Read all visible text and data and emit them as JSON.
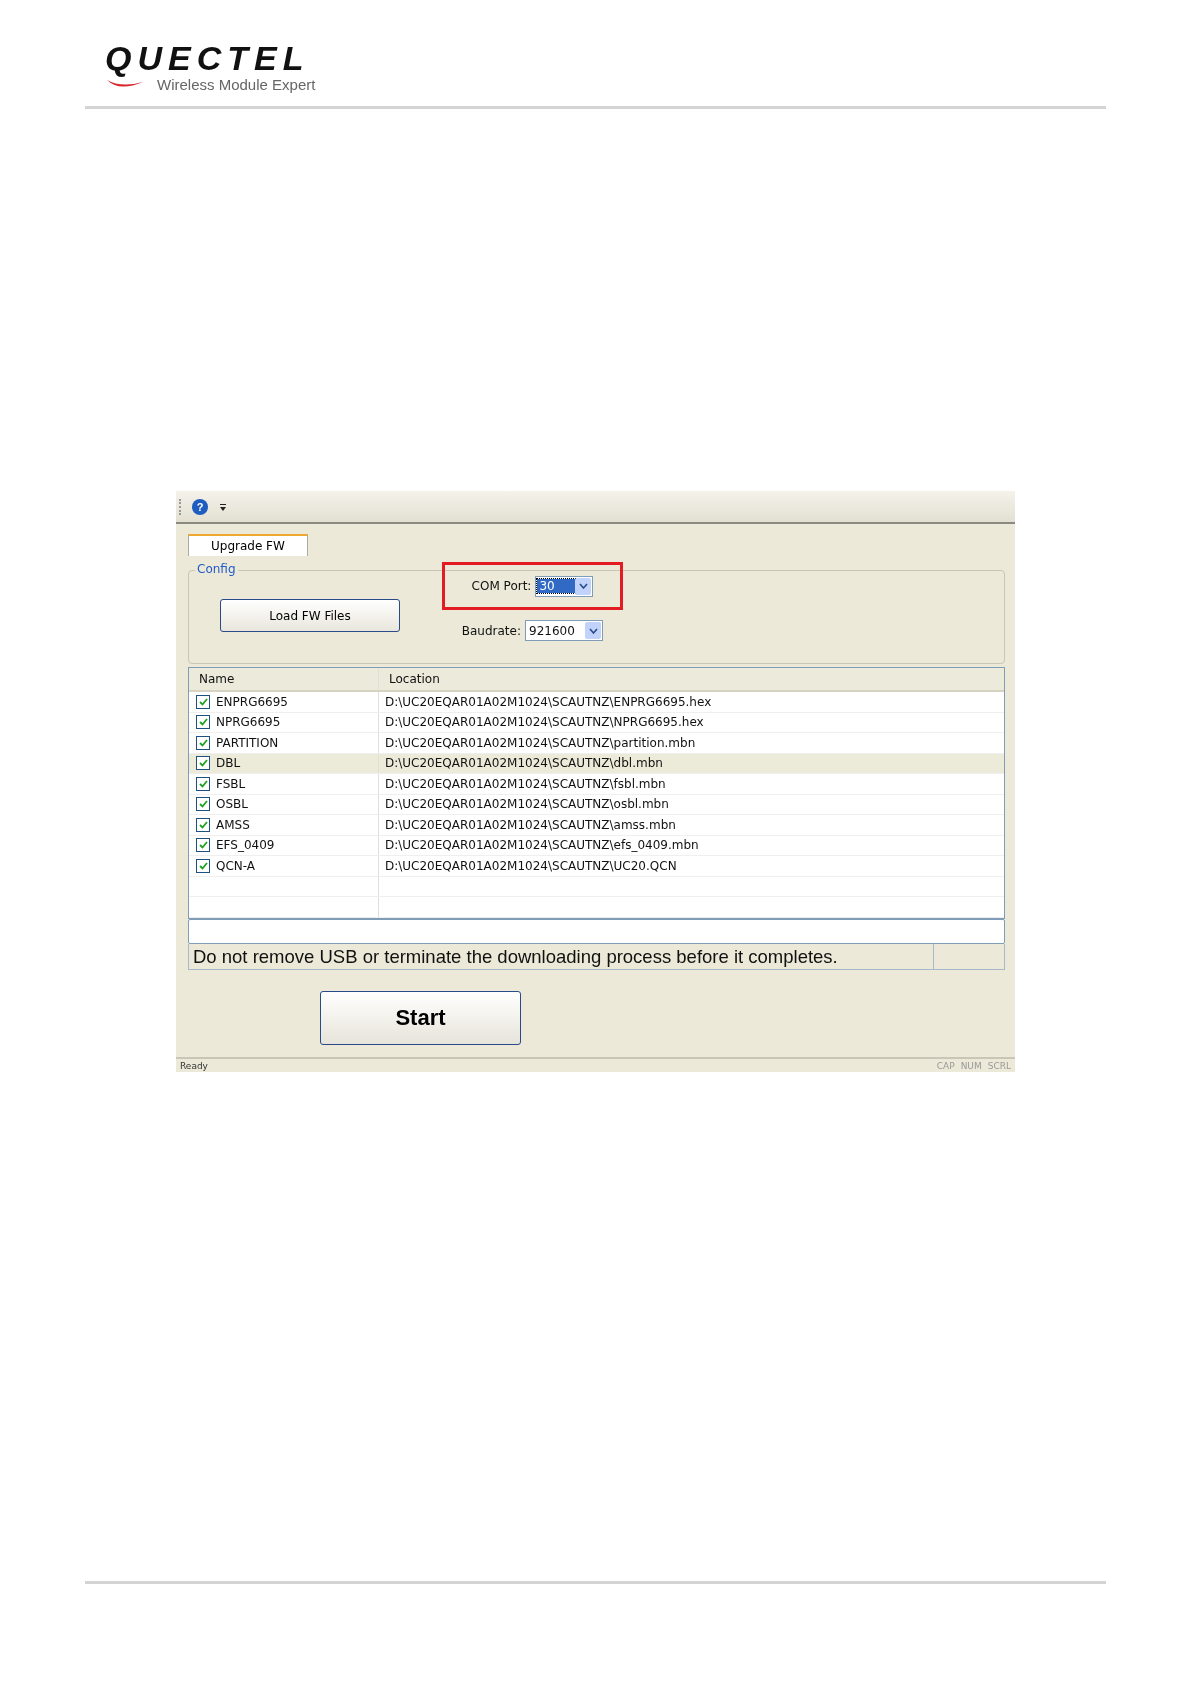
{
  "header": {
    "logo": "QUECTEL",
    "tagline": "Wireless Module Expert"
  },
  "window": {
    "toolbar": {
      "help_button": "?"
    },
    "tabs": [
      {
        "label": "Upgrade FW",
        "selected": true
      }
    ],
    "config": {
      "title": "Config",
      "load_button": "Load FW Files",
      "com_port": {
        "label": "COM Port:",
        "value": "30",
        "highlighted": true
      },
      "baudrate": {
        "label": "Baudrate:",
        "value": "921600"
      }
    },
    "table": {
      "columns": [
        "Name",
        "Location"
      ],
      "rows": [
        {
          "name": "ENPRG6695",
          "location": "D:\\UC20EQAR01A02M1024\\SCAUTNZ\\ENPRG6695.hex",
          "checked": true,
          "selected": false
        },
        {
          "name": "NPRG6695",
          "location": "D:\\UC20EQAR01A02M1024\\SCAUTNZ\\NPRG6695.hex",
          "checked": true,
          "selected": false
        },
        {
          "name": "PARTITION",
          "location": "D:\\UC20EQAR01A02M1024\\SCAUTNZ\\partition.mbn",
          "checked": true,
          "selected": false
        },
        {
          "name": "DBL",
          "location": "D:\\UC20EQAR01A02M1024\\SCAUTNZ\\dbl.mbn",
          "checked": true,
          "selected": true
        },
        {
          "name": "FSBL",
          "location": "D:\\UC20EQAR01A02M1024\\SCAUTNZ\\fsbl.mbn",
          "checked": true,
          "selected": false
        },
        {
          "name": "OSBL",
          "location": "D:\\UC20EQAR01A02M1024\\SCAUTNZ\\osbl.mbn",
          "checked": true,
          "selected": false
        },
        {
          "name": "AMSS",
          "location": "D:\\UC20EQAR01A02M1024\\SCAUTNZ\\amss.mbn",
          "checked": true,
          "selected": false
        },
        {
          "name": "EFS_0409",
          "location": "D:\\UC20EQAR01A02M1024\\SCAUTNZ\\efs_0409.mbn",
          "checked": true,
          "selected": false
        },
        {
          "name": "QCN-A",
          "location": "D:\\UC20EQAR01A02M1024\\SCAUTNZ\\UC20.QCN",
          "checked": true,
          "selected": false
        }
      ]
    },
    "message": "Do not remove USB or terminate the downloading process before it completes.",
    "start_button": "Start",
    "status_bar": {
      "text": "Ready",
      "indicators": [
        "CAP",
        "NUM",
        "SCRL"
      ]
    }
  }
}
